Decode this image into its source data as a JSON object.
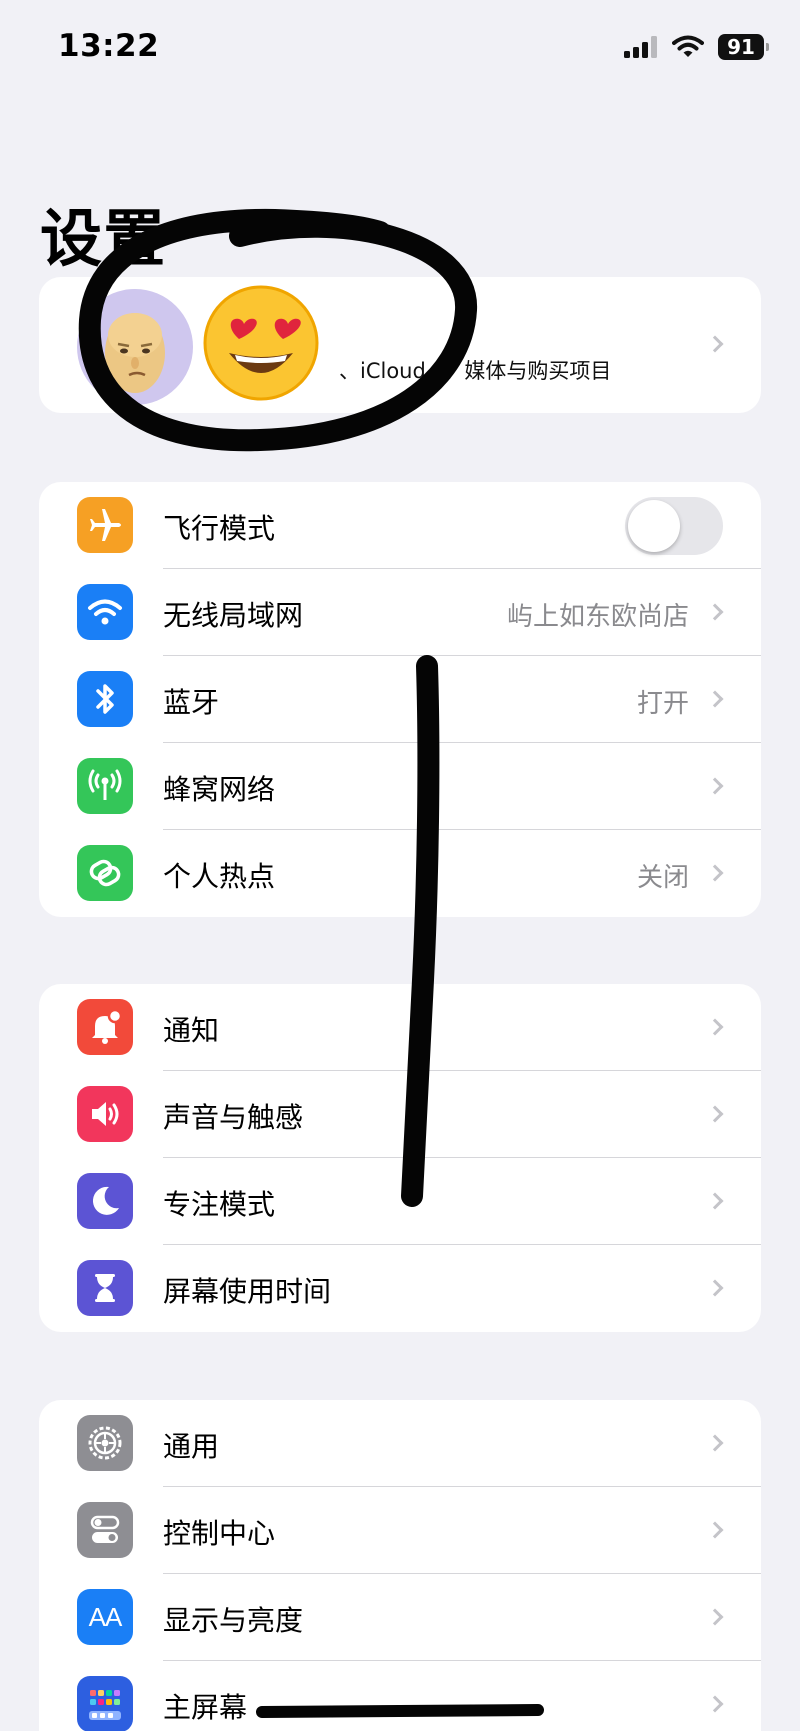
{
  "status_bar": {
    "time": "13:22",
    "battery": "91"
  },
  "title": "设置",
  "profile": {
    "subtitle": "、iCloud+、媒体与购买项目"
  },
  "groups": [
    {
      "rows": [
        {
          "label": "飞行模式",
          "icon": "airplane-icon",
          "color": "#f6a024",
          "toggle": false
        },
        {
          "label": "无线局域网",
          "icon": "wifi-icon",
          "color": "#1a7ff6",
          "value": "屿上如东欧尚店"
        },
        {
          "label": "蓝牙",
          "icon": "bluetooth-icon",
          "color": "#1a7ff6",
          "value": "打开"
        },
        {
          "label": "蜂窝网络",
          "icon": "cellular-antenna-icon",
          "color": "#34c659",
          "value": ""
        },
        {
          "label": "个人热点",
          "icon": "hotspot-link-icon",
          "color": "#34c659",
          "value": "关闭"
        }
      ]
    },
    {
      "rows": [
        {
          "label": "通知",
          "icon": "notification-bell-icon",
          "color": "#f24a3a"
        },
        {
          "label": "声音与触感",
          "icon": "speaker-icon",
          "color": "#f2365c"
        },
        {
          "label": "专注模式",
          "icon": "moon-icon",
          "color": "#5c54d4"
        },
        {
          "label": "屏幕使用时间",
          "icon": "hourglass-icon",
          "color": "#5c54d4"
        }
      ]
    },
    {
      "rows": [
        {
          "label": "通用",
          "icon": "gear-icon",
          "color": "#8e8e93"
        },
        {
          "label": "控制中心",
          "icon": "toggles-icon",
          "color": "#8e8e93"
        },
        {
          "label": "显示与亮度",
          "icon": "text-size-icon",
          "color": "#1a7ff6",
          "glyph": "AA"
        },
        {
          "label": "主屏幕",
          "icon": "home-grid-icon",
          "color": "#2d5fe0"
        }
      ]
    }
  ]
}
